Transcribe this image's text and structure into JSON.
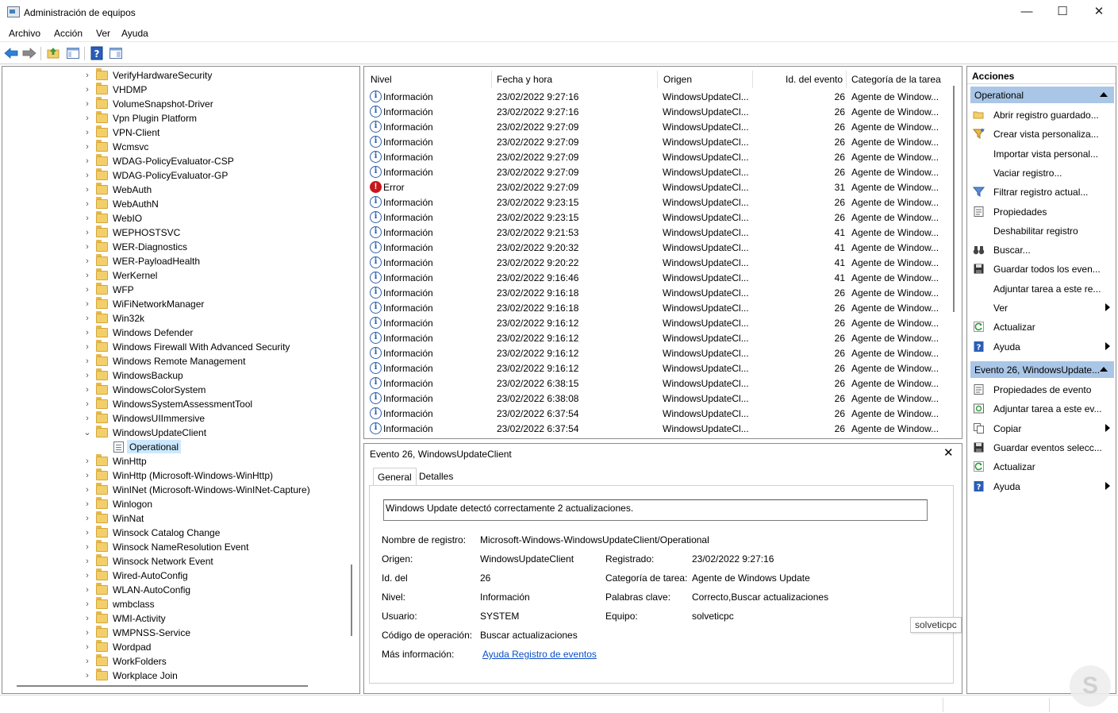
{
  "window": {
    "title": "Administración de equipos",
    "minimize": "—",
    "maximize": "☐",
    "close": "✕"
  },
  "menu": [
    "Archivo",
    "Acción",
    "Ver",
    "Ayuda"
  ],
  "tree": {
    "items": [
      "VerifyHardwareSecurity",
      "VHDMP",
      "VolumeSnapshot-Driver",
      "Vpn Plugin Platform",
      "VPN-Client",
      "Wcmsvc",
      "WDAG-PolicyEvaluator-CSP",
      "WDAG-PolicyEvaluator-GP",
      "WebAuth",
      "WebAuthN",
      "WebIO",
      "WEPHOSTSVC",
      "WER-Diagnostics",
      "WER-PayloadHealth",
      "WerKernel",
      "WFP",
      "WiFiNetworkManager",
      "Win32k",
      "Windows Defender",
      "Windows Firewall With Advanced Security",
      "Windows Remote Management",
      "WindowsBackup",
      "WindowsColorSystem",
      "WindowsSystemAssessmentTool",
      "WindowsUIImmersive",
      "WindowsUpdateClient",
      "Operational",
      "WinHttp",
      "WinHttp (Microsoft-Windows-WinHttp)",
      "WinINet (Microsoft-Windows-WinINet-Capture)",
      "Winlogon",
      "WinNat",
      "Winsock Catalog Change",
      "Winsock NameResolution Event",
      "Winsock Network Event",
      "Wired-AutoConfig",
      "WLAN-AutoConfig",
      "wmbclass",
      "WMI-Activity",
      "WMPNSS-Service",
      "Wordpad",
      "WorkFolders",
      "Workplace Join"
    ]
  },
  "events": {
    "columns": [
      "Nivel",
      "Fecha y hora",
      "Origen",
      "Id. del evento",
      "Categoría de la tarea"
    ],
    "rows": [
      [
        "Información",
        "23/02/2022 9:27:16",
        "WindowsUpdateCl...",
        "26",
        "Agente de Window..."
      ],
      [
        "Información",
        "23/02/2022 9:27:16",
        "WindowsUpdateCl...",
        "26",
        "Agente de Window..."
      ],
      [
        "Información",
        "23/02/2022 9:27:09",
        "WindowsUpdateCl...",
        "26",
        "Agente de Window..."
      ],
      [
        "Información",
        "23/02/2022 9:27:09",
        "WindowsUpdateCl...",
        "26",
        "Agente de Window..."
      ],
      [
        "Información",
        "23/02/2022 9:27:09",
        "WindowsUpdateCl...",
        "26",
        "Agente de Window..."
      ],
      [
        "Información",
        "23/02/2022 9:27:09",
        "WindowsUpdateCl...",
        "26",
        "Agente de Window..."
      ],
      [
        "Error",
        "23/02/2022 9:27:09",
        "WindowsUpdateCl...",
        "31",
        "Agente de Window..."
      ],
      [
        "Información",
        "23/02/2022 9:23:15",
        "WindowsUpdateCl...",
        "26",
        "Agente de Window..."
      ],
      [
        "Información",
        "23/02/2022 9:23:15",
        "WindowsUpdateCl...",
        "26",
        "Agente de Window..."
      ],
      [
        "Información",
        "23/02/2022 9:21:53",
        "WindowsUpdateCl...",
        "41",
        "Agente de Window..."
      ],
      [
        "Información",
        "23/02/2022 9:20:32",
        "WindowsUpdateCl...",
        "41",
        "Agente de Window..."
      ],
      [
        "Información",
        "23/02/2022 9:20:22",
        "WindowsUpdateCl...",
        "41",
        "Agente de Window..."
      ],
      [
        "Información",
        "23/02/2022 9:16:46",
        "WindowsUpdateCl...",
        "41",
        "Agente de Window..."
      ],
      [
        "Información",
        "23/02/2022 9:16:18",
        "WindowsUpdateCl...",
        "26",
        "Agente de Window..."
      ],
      [
        "Información",
        "23/02/2022 9:16:18",
        "WindowsUpdateCl...",
        "26",
        "Agente de Window..."
      ],
      [
        "Información",
        "23/02/2022 9:16:12",
        "WindowsUpdateCl...",
        "26",
        "Agente de Window..."
      ],
      [
        "Información",
        "23/02/2022 9:16:12",
        "WindowsUpdateCl...",
        "26",
        "Agente de Window..."
      ],
      [
        "Información",
        "23/02/2022 9:16:12",
        "WindowsUpdateCl...",
        "26",
        "Agente de Window..."
      ],
      [
        "Información",
        "23/02/2022 9:16:12",
        "WindowsUpdateCl...",
        "26",
        "Agente de Window..."
      ],
      [
        "Información",
        "23/02/2022 6:38:15",
        "WindowsUpdateCl...",
        "26",
        "Agente de Window..."
      ],
      [
        "Información",
        "23/02/2022 6:38:08",
        "WindowsUpdateCl...",
        "26",
        "Agente de Window..."
      ],
      [
        "Información",
        "23/02/2022 6:37:54",
        "WindowsUpdateCl...",
        "26",
        "Agente de Window..."
      ],
      [
        "Información",
        "23/02/2022 6:37:54",
        "WindowsUpdateCl...",
        "26",
        "Agente de Window..."
      ]
    ]
  },
  "detail": {
    "header": "Evento 26, WindowsUpdateClient",
    "tabs": [
      "General",
      "Detalles"
    ],
    "message": "Windows Update detectó correctamente 2 actualizaciones.",
    "fields": {
      "log_name_label": "Nombre de registro:",
      "log_name": "Microsoft-Windows-WindowsUpdateClient/Operational",
      "source_label": "Origen:",
      "source": "WindowsUpdateClient",
      "logged_label": "Registrado:",
      "logged": "23/02/2022 9:27:16",
      "event_id_label": "Id. del",
      "event_id": "26",
      "task_cat_label": "Categoría de tarea:",
      "task_cat": "Agente de Windows Update",
      "level_label": "Nivel:",
      "level": "Información",
      "keywords_label": "Palabras clave:",
      "keywords": "Correcto,Buscar actualizaciones",
      "user_label": "Usuario:",
      "user": "SYSTEM",
      "computer_label": "Equipo:",
      "computer": "solveticpc",
      "opcode_label": "Código de operación:",
      "opcode": "Buscar actualizaciones",
      "more_info_label": "Más información:",
      "more_info_link": "Ayuda Registro de eventos"
    },
    "tooltip": "solveticpc"
  },
  "actions": {
    "header": "Acciones",
    "section1": "Operational",
    "items1": [
      {
        "label": "Abrir registro guardado...",
        "icon": "folder-open-icon",
        "arrow": false
      },
      {
        "label": "Crear vista personaliza...",
        "icon": "filter-star-icon",
        "arrow": false
      },
      {
        "label": "Importar vista personal...",
        "icon": "",
        "arrow": false
      },
      {
        "label": "Vaciar registro...",
        "icon": "",
        "arrow": false
      },
      {
        "label": "Filtrar registro actual...",
        "icon": "filter-icon",
        "arrow": false
      },
      {
        "label": "Propiedades",
        "icon": "properties-icon",
        "arrow": false
      },
      {
        "label": "Deshabilitar registro",
        "icon": "",
        "arrow": false
      },
      {
        "label": "Buscar...",
        "icon": "binoculars-icon",
        "arrow": false
      },
      {
        "label": "Guardar todos los even...",
        "icon": "save-icon",
        "arrow": false
      },
      {
        "label": "Adjuntar tarea a este re...",
        "icon": "",
        "arrow": false
      },
      {
        "label": "Ver",
        "icon": "",
        "arrow": true
      },
      {
        "label": "Actualizar",
        "icon": "refresh-icon",
        "arrow": false
      },
      {
        "label": "Ayuda",
        "icon": "help-icon",
        "arrow": true
      }
    ],
    "section2": "Evento 26, WindowsUpdate...",
    "items2": [
      {
        "label": "Propiedades de evento",
        "icon": "properties-icon",
        "arrow": false
      },
      {
        "label": "Adjuntar tarea a este ev...",
        "icon": "task-icon",
        "arrow": false
      },
      {
        "label": "Copiar",
        "icon": "copy-icon",
        "arrow": true
      },
      {
        "label": "Guardar eventos selecc...",
        "icon": "save-icon",
        "arrow": false
      },
      {
        "label": "Actualizar",
        "icon": "refresh-icon",
        "arrow": false
      },
      {
        "label": "Ayuda",
        "icon": "help-icon",
        "arrow": true
      }
    ]
  },
  "colors": {
    "accent": "#a9c6e7",
    "selection": "#cce8ff",
    "link": "#0b4fc6",
    "error": "#c8161d",
    "info": "#2e5fa8"
  }
}
